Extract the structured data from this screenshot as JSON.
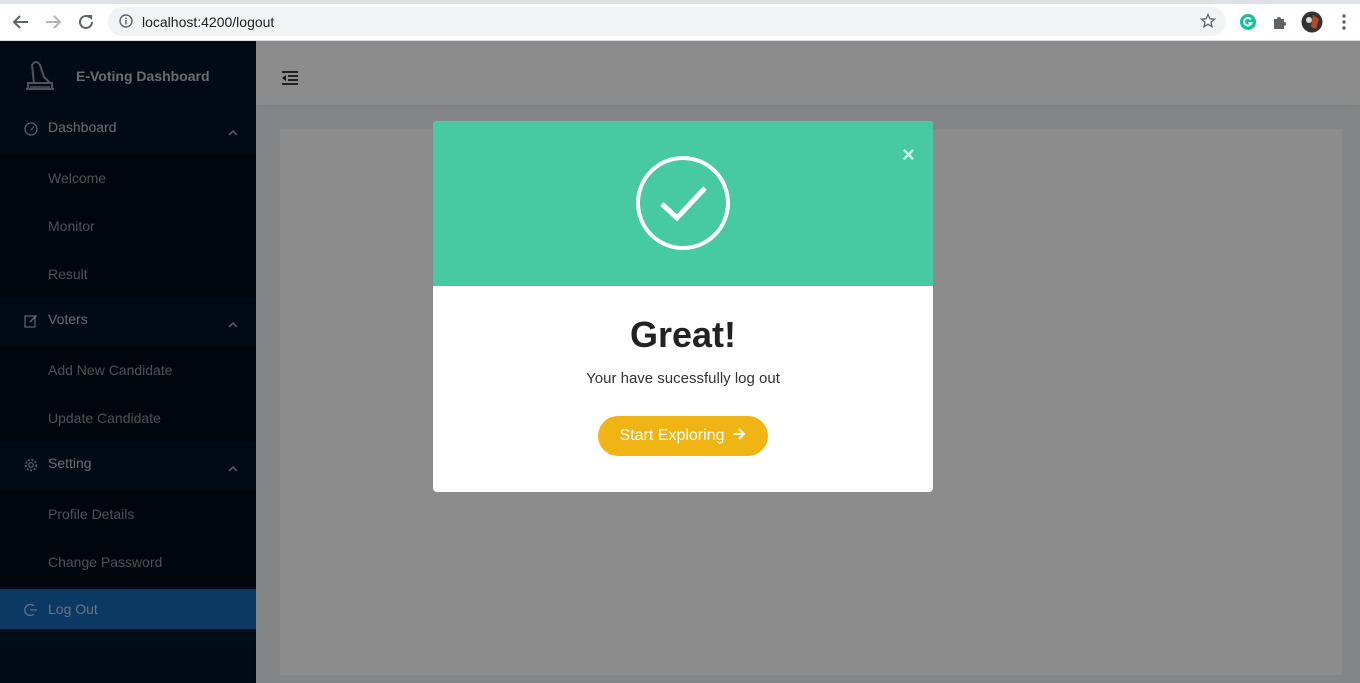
{
  "browser": {
    "url": "localhost:4200/logout"
  },
  "sidebar": {
    "brand_title": "E-Voting Dashboard",
    "groups": [
      {
        "label": "Dashboard",
        "items": [
          "Welcome",
          "Monitor",
          "Result"
        ]
      },
      {
        "label": "Voters",
        "items": [
          "Add New Candidate",
          "Update Candidate"
        ]
      },
      {
        "label": "Setting",
        "items": [
          "Profile Details",
          "Change Password"
        ]
      }
    ],
    "active_item": "Log Out"
  },
  "modal": {
    "title": "Great!",
    "message": "Your have sucessfully log out",
    "button_label": "Start Exploring",
    "close_symbol": "×",
    "header_color": "#47c9a2",
    "button_color": "#f0b415"
  },
  "colors": {
    "sidebar_bg": "#001529",
    "active_bg": "#1368b4"
  }
}
